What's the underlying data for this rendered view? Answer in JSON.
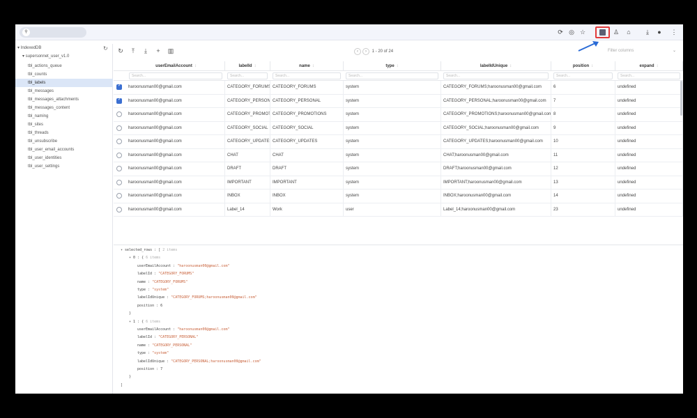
{
  "browser": {
    "toolbar_icons": [
      "cast-icon",
      "translate-icon",
      "star-icon",
      "extension-active-icon",
      "profile-icon",
      "extensions-icon",
      "download-icon",
      "account-icon",
      "menu-icon"
    ]
  },
  "tree": {
    "root": "IndexedDB",
    "database": "supersonnet_user_v1.0",
    "tables": [
      "tbl_actions_queue",
      "tbl_counts",
      "tbl_labels",
      "tbl_messages",
      "tbl_messages_attachments",
      "tbl_messages_content",
      "tbl_naming",
      "tbl_sites",
      "tbl_threads",
      "tbl_unsubscribe",
      "tbl_user_email_accounts",
      "tbl_user_identities",
      "tbl_user_settings"
    ],
    "selected_index": 2
  },
  "toolbar": {
    "pager_text": "1 - 20 of 24",
    "filter_placeholder": "Filter columns"
  },
  "table": {
    "columns": [
      "userEmailAccount",
      "labelId",
      "name",
      "type",
      "labelIdUnique",
      "position",
      "expand"
    ],
    "search_placeholder": "Search...",
    "rows": [
      {
        "checked": true,
        "cells": [
          "haroonusman00@gmail.com",
          "CATEGORY_FORUMS",
          "CATEGORY_FORUMS",
          "system",
          "CATEGORY_FORUMS;haroonusman00@gmail.com",
          "6",
          "undefined"
        ]
      },
      {
        "checked": true,
        "cells": [
          "haroonusman00@gmail.com",
          "CATEGORY_PERSONAL",
          "CATEGORY_PERSONAL",
          "system",
          "CATEGORY_PERSONAL;haroonusman00@gmail.com",
          "7",
          "undefined"
        ]
      },
      {
        "checked": false,
        "cells": [
          "haroonusman00@gmail.com",
          "CATEGORY_PROMOTIONS",
          "CATEGORY_PROMOTIONS",
          "system",
          "CATEGORY_PROMOTIONS;haroonusman00@gmail.com",
          "8",
          "undefined"
        ]
      },
      {
        "checked": false,
        "cells": [
          "haroonusman00@gmail.com",
          "CATEGORY_SOCIAL",
          "CATEGORY_SOCIAL",
          "system",
          "CATEGORY_SOCIAL;haroonusman00@gmail.com",
          "9",
          "undefined"
        ]
      },
      {
        "checked": false,
        "cells": [
          "haroonusman00@gmail.com",
          "CATEGORY_UPDATES",
          "CATEGORY_UPDATES",
          "system",
          "CATEGORY_UPDATES;haroonusman00@gmail.com",
          "10",
          "undefined"
        ]
      },
      {
        "checked": false,
        "cells": [
          "haroonusman00@gmail.com",
          "CHAT",
          "CHAT",
          "system",
          "CHAT;haroonusman00@gmail.com",
          "11",
          "undefined"
        ]
      },
      {
        "checked": false,
        "cells": [
          "haroonusman00@gmail.com",
          "DRAFT",
          "DRAFT",
          "system",
          "DRAFT;haroonusman00@gmail.com",
          "12",
          "undefined"
        ]
      },
      {
        "checked": false,
        "cells": [
          "haroonusman00@gmail.com",
          "IMPORTANT",
          "IMPORTANT",
          "system",
          "IMPORTANT;haroonusman00@gmail.com",
          "13",
          "undefined"
        ]
      },
      {
        "checked": false,
        "cells": [
          "haroonusman00@gmail.com",
          "INBOX",
          "INBOX",
          "system",
          "INBOX;haroonusman00@gmail.com",
          "14",
          "undefined"
        ]
      },
      {
        "checked": false,
        "cells": [
          "haroonusman00@gmail.com",
          "Label_14",
          "Work",
          "user",
          "Label_14;haroonusman00@gmail.com",
          "23",
          "undefined"
        ]
      }
    ]
  },
  "json_view": {
    "root_key": "selected_rows",
    "root_meta": "2 items",
    "items": [
      {
        "index": "0",
        "meta": "6 items",
        "fields": [
          {
            "k": "userEmailAccount",
            "v": "\"haroonusman00@gmail.com\"",
            "str": true
          },
          {
            "k": "labelId",
            "v": "\"CATEGORY_FORUMS\"",
            "str": true
          },
          {
            "k": "name",
            "v": "\"CATEGORY_FORUMS\"",
            "str": true
          },
          {
            "k": "type",
            "v": "\"system\"",
            "str": true
          },
          {
            "k": "labelIdUnique",
            "v": "\"CATEGORY_FORUMS;haroonusman00@gmail.com\"",
            "str": true
          },
          {
            "k": "position",
            "v": "6",
            "str": false
          }
        ]
      },
      {
        "index": "1",
        "meta": "6 items",
        "fields": [
          {
            "k": "userEmailAccount",
            "v": "\"haroonusman00@gmail.com\"",
            "str": true
          },
          {
            "k": "labelId",
            "v": "\"CATEGORY_PERSONAL\"",
            "str": true
          },
          {
            "k": "name",
            "v": "\"CATEGORY_PERSONAL\"",
            "str": true
          },
          {
            "k": "type",
            "v": "\"system\"",
            "str": true
          },
          {
            "k": "labelIdUnique",
            "v": "\"CATEGORY_PERSONAL;haroonusman00@gmail.com\"",
            "str": true
          },
          {
            "k": "position",
            "v": "7",
            "str": false
          }
        ]
      }
    ]
  },
  "colors": {
    "accent": "#3b6fd1",
    "highlight_box": "#e23a3a",
    "string_value": "#c8613a"
  }
}
